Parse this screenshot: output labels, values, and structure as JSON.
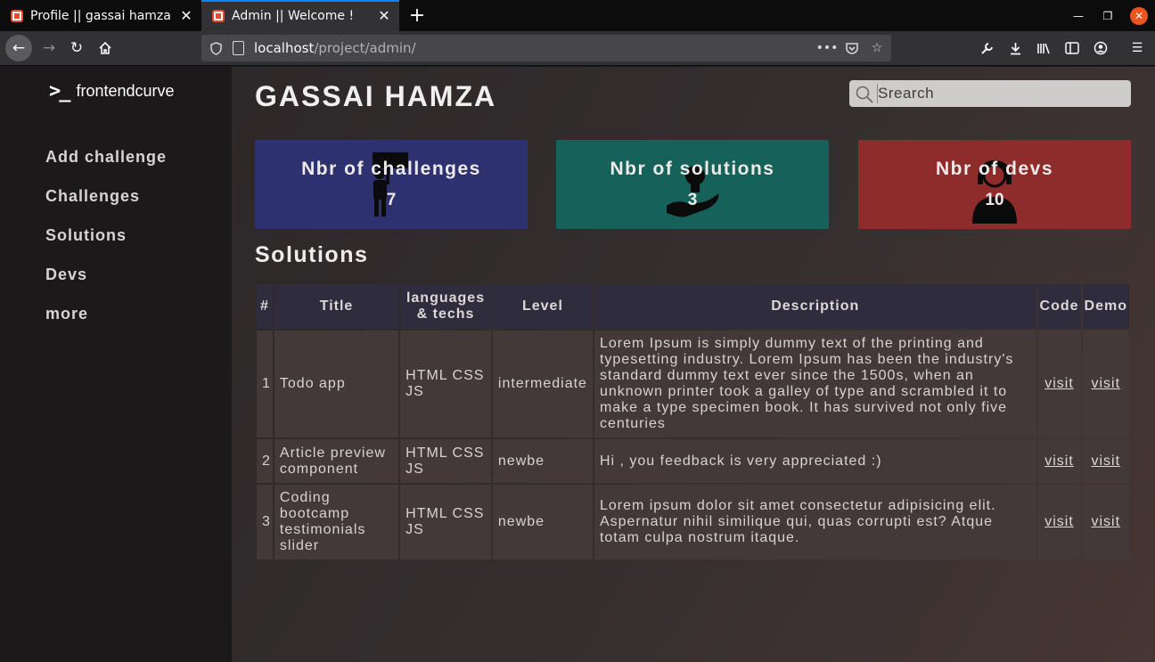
{
  "browser": {
    "tabs": [
      {
        "title": "Profile || gassai hamza",
        "active": false
      },
      {
        "title": "Admin || Welcome !",
        "active": true
      }
    ],
    "new_tab_label": "+",
    "url_host": "localhost",
    "url_path": "/project/admin/",
    "accent": "#0a84ff"
  },
  "sidebar": {
    "logo_text": "frontendcurve",
    "items": [
      {
        "label": "Add challenge"
      },
      {
        "label": "Challenges"
      },
      {
        "label": "Solutions"
      },
      {
        "label": "Devs"
      },
      {
        "label": "more"
      }
    ]
  },
  "header": {
    "title": "GASSAI HAMZA",
    "search_placeholder": "Srearch"
  },
  "stats": [
    {
      "label": "Nbr of challenges",
      "value": "7",
      "color": "#2e3170",
      "icon": "person-with-sign-icon"
    },
    {
      "label": "Nbr of solutions",
      "value": "3",
      "color": "#16625a",
      "icon": "hand-holding-bulb-icon"
    },
    {
      "label": "Nbr of devs",
      "value": "10",
      "color": "#8e2b2b",
      "icon": "developer-headset-icon"
    }
  ],
  "solutions": {
    "title": "Solutions",
    "columns": [
      "#",
      "Title",
      "languages & techs",
      "Level",
      "Description",
      "Code",
      "Demo"
    ],
    "rows": [
      {
        "num": "1",
        "title": "Todo app",
        "techs": "HTML CSS JS",
        "level": "intermediate",
        "description": "Lorem Ipsum is simply dummy text of the printing and typesetting industry. Lorem Ipsum has been the industry's standard dummy text ever since the 1500s, when an unknown printer took a galley of type and scrambled it to make a type specimen book. It has survived not only five centuries",
        "code": "visit",
        "demo": "visit"
      },
      {
        "num": "2",
        "title": "Article preview component",
        "techs": "HTML CSS JS",
        "level": "newbe",
        "description": "Hi , you feedback is very appreciated :)",
        "code": "visit",
        "demo": "visit"
      },
      {
        "num": "3",
        "title": "Coding bootcamp testimonials slider",
        "techs": "HTML CSS JS",
        "level": "newbe",
        "description": "Lorem ipsum dolor sit amet consectetur adipisicing elit. Aspernatur nihil similique qui, quas corrupti est? Atque totam culpa nostrum itaque.",
        "code": "visit",
        "demo": "visit"
      }
    ]
  }
}
